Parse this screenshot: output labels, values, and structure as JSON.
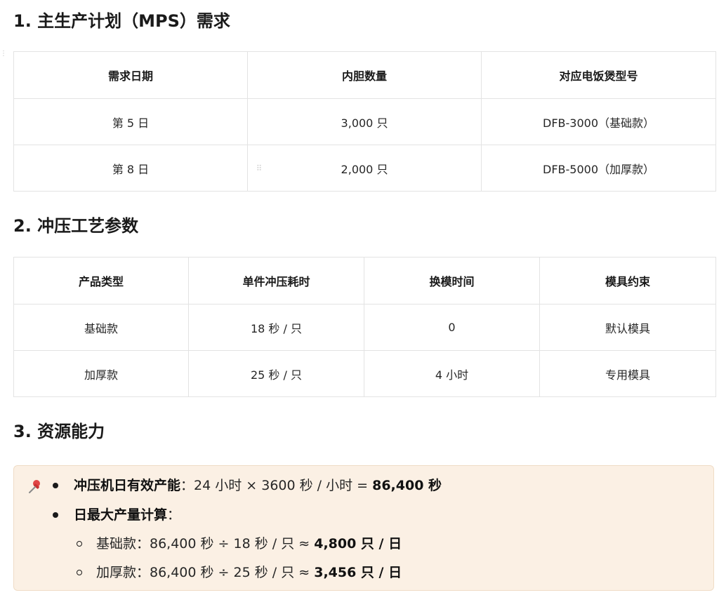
{
  "section1": {
    "heading": "1. 主生产计划（MPS）需求",
    "table": {
      "headers": [
        "需求日期",
        "内胆数量",
        "对应电饭煲型号"
      ],
      "rows": [
        [
          "第 5 日",
          "3,000 只",
          "DFB-3000（基础款）"
        ],
        [
          "第 8 日",
          "2,000 只",
          "DFB-5000（加厚款）"
        ]
      ]
    }
  },
  "section2": {
    "heading": "2. 冲压工艺参数",
    "table": {
      "headers": [
        "产品类型",
        "单件冲压耗时",
        "换模时间",
        "模具约束"
      ],
      "rows": [
        [
          "基础款",
          "18 秒 / 只",
          "0",
          "默认模具"
        ],
        [
          "加厚款",
          "25 秒 / 只",
          "4 小时",
          "专用模具"
        ]
      ]
    }
  },
  "section3": {
    "heading": "3. 资源能力",
    "callout": {
      "icon": "pushpin-icon",
      "items": [
        {
          "label": "冲压机日有效产能",
          "text": "：24 小时 × 3600 秒 / 小时 = ",
          "result": "86,400 秒"
        },
        {
          "label": "日最大产量计算",
          "text": "："
        }
      ],
      "subitems": [
        {
          "text": "基础款：86,400 秒 ÷ 18 秒 / 只 ≈ ",
          "result": "4,800 只 / 日"
        },
        {
          "text": "加厚款：86,400 秒 ÷ 25 秒 / 只 ≈ ",
          "result": "3,456 只 / 日"
        }
      ]
    }
  },
  "colors": {
    "callout_bg": "#fbf0e4",
    "callout_border": "#efdcc6",
    "table_border": "#e3e3e3"
  }
}
